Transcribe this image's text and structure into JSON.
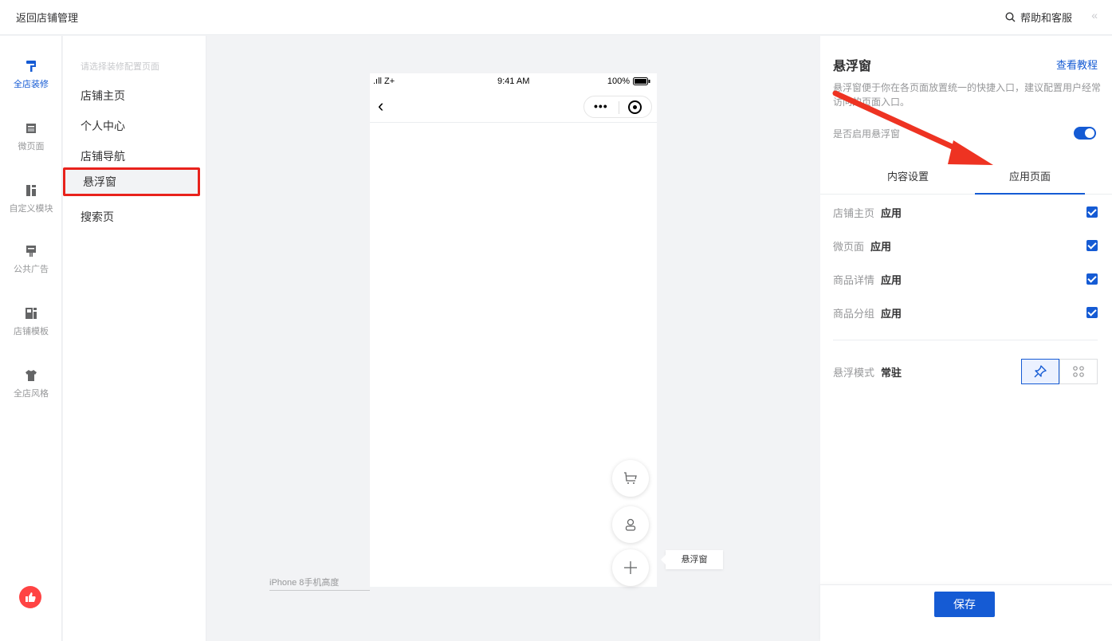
{
  "topbar": {
    "back_label": "返回店铺管理",
    "help_label": "帮助和客服",
    "collapse_icon": "«"
  },
  "rail": {
    "items": [
      {
        "label": "全店装修",
        "icon": "paint-roller-icon",
        "active": true
      },
      {
        "label": "微页面",
        "icon": "page-icon",
        "active": false
      },
      {
        "label": "自定义模块",
        "icon": "module-icon",
        "active": false
      },
      {
        "label": "公共广告",
        "icon": "billboard-icon",
        "active": false
      },
      {
        "label": "店铺模板",
        "icon": "template-icon",
        "active": false
      },
      {
        "label": "全店风格",
        "icon": "tshirt-icon",
        "active": false
      }
    ]
  },
  "pages": {
    "hint": "请选择装修配置页面",
    "items": [
      "店铺主页",
      "个人中心",
      "店铺导航",
      "悬浮窗",
      "搜索页"
    ],
    "selected_index": 3
  },
  "preview": {
    "signal": ".ıll Z+",
    "time": "9:41 AM",
    "battery": "100%",
    "float_label": "悬浮窗",
    "device_label": "iPhone 8手机高度"
  },
  "panel": {
    "title": "悬浮窗",
    "tutorial_link": "查看教程",
    "description": "悬浮窗便于你在各页面放置统一的快捷入口，建议配置用户经常访问的页面入口。",
    "enable_label": "是否启用悬浮窗",
    "enabled": true,
    "tabs": [
      "内容设置",
      "应用页面"
    ],
    "active_tab": 1,
    "apply_rows": [
      {
        "page": "店铺主页",
        "value": "应用",
        "checked": true
      },
      {
        "page": "微页面",
        "value": "应用",
        "checked": true
      },
      {
        "page": "商品详情",
        "value": "应用",
        "checked": true
      },
      {
        "page": "商品分组",
        "value": "应用",
        "checked": true
      }
    ],
    "mode_label": "悬浮模式",
    "mode_value": "常驻",
    "save_label": "保存"
  },
  "colors": {
    "accent": "#155bd4",
    "highlight_box": "#e8221c",
    "annotation_arrow": "#ee3322"
  }
}
